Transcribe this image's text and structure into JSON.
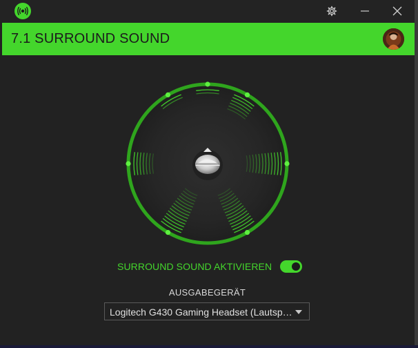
{
  "window": {
    "icons": {
      "logo": "razer-logo-icon",
      "settings": "gear-icon",
      "minimize": "minimize-icon",
      "close": "close-icon"
    }
  },
  "header": {
    "title": "7.1 SURROUND SOUND",
    "avatar_icon": "user-avatar"
  },
  "surround": {
    "toggle_label": "SURROUND SOUND AKTIVIEREN",
    "enabled": true
  },
  "output": {
    "label": "AUSGABEGERÄT",
    "selected": "Logitech G430 Gaming Headset (Lautsp…"
  },
  "colors": {
    "accent": "#44d62c",
    "background": "#222222"
  }
}
